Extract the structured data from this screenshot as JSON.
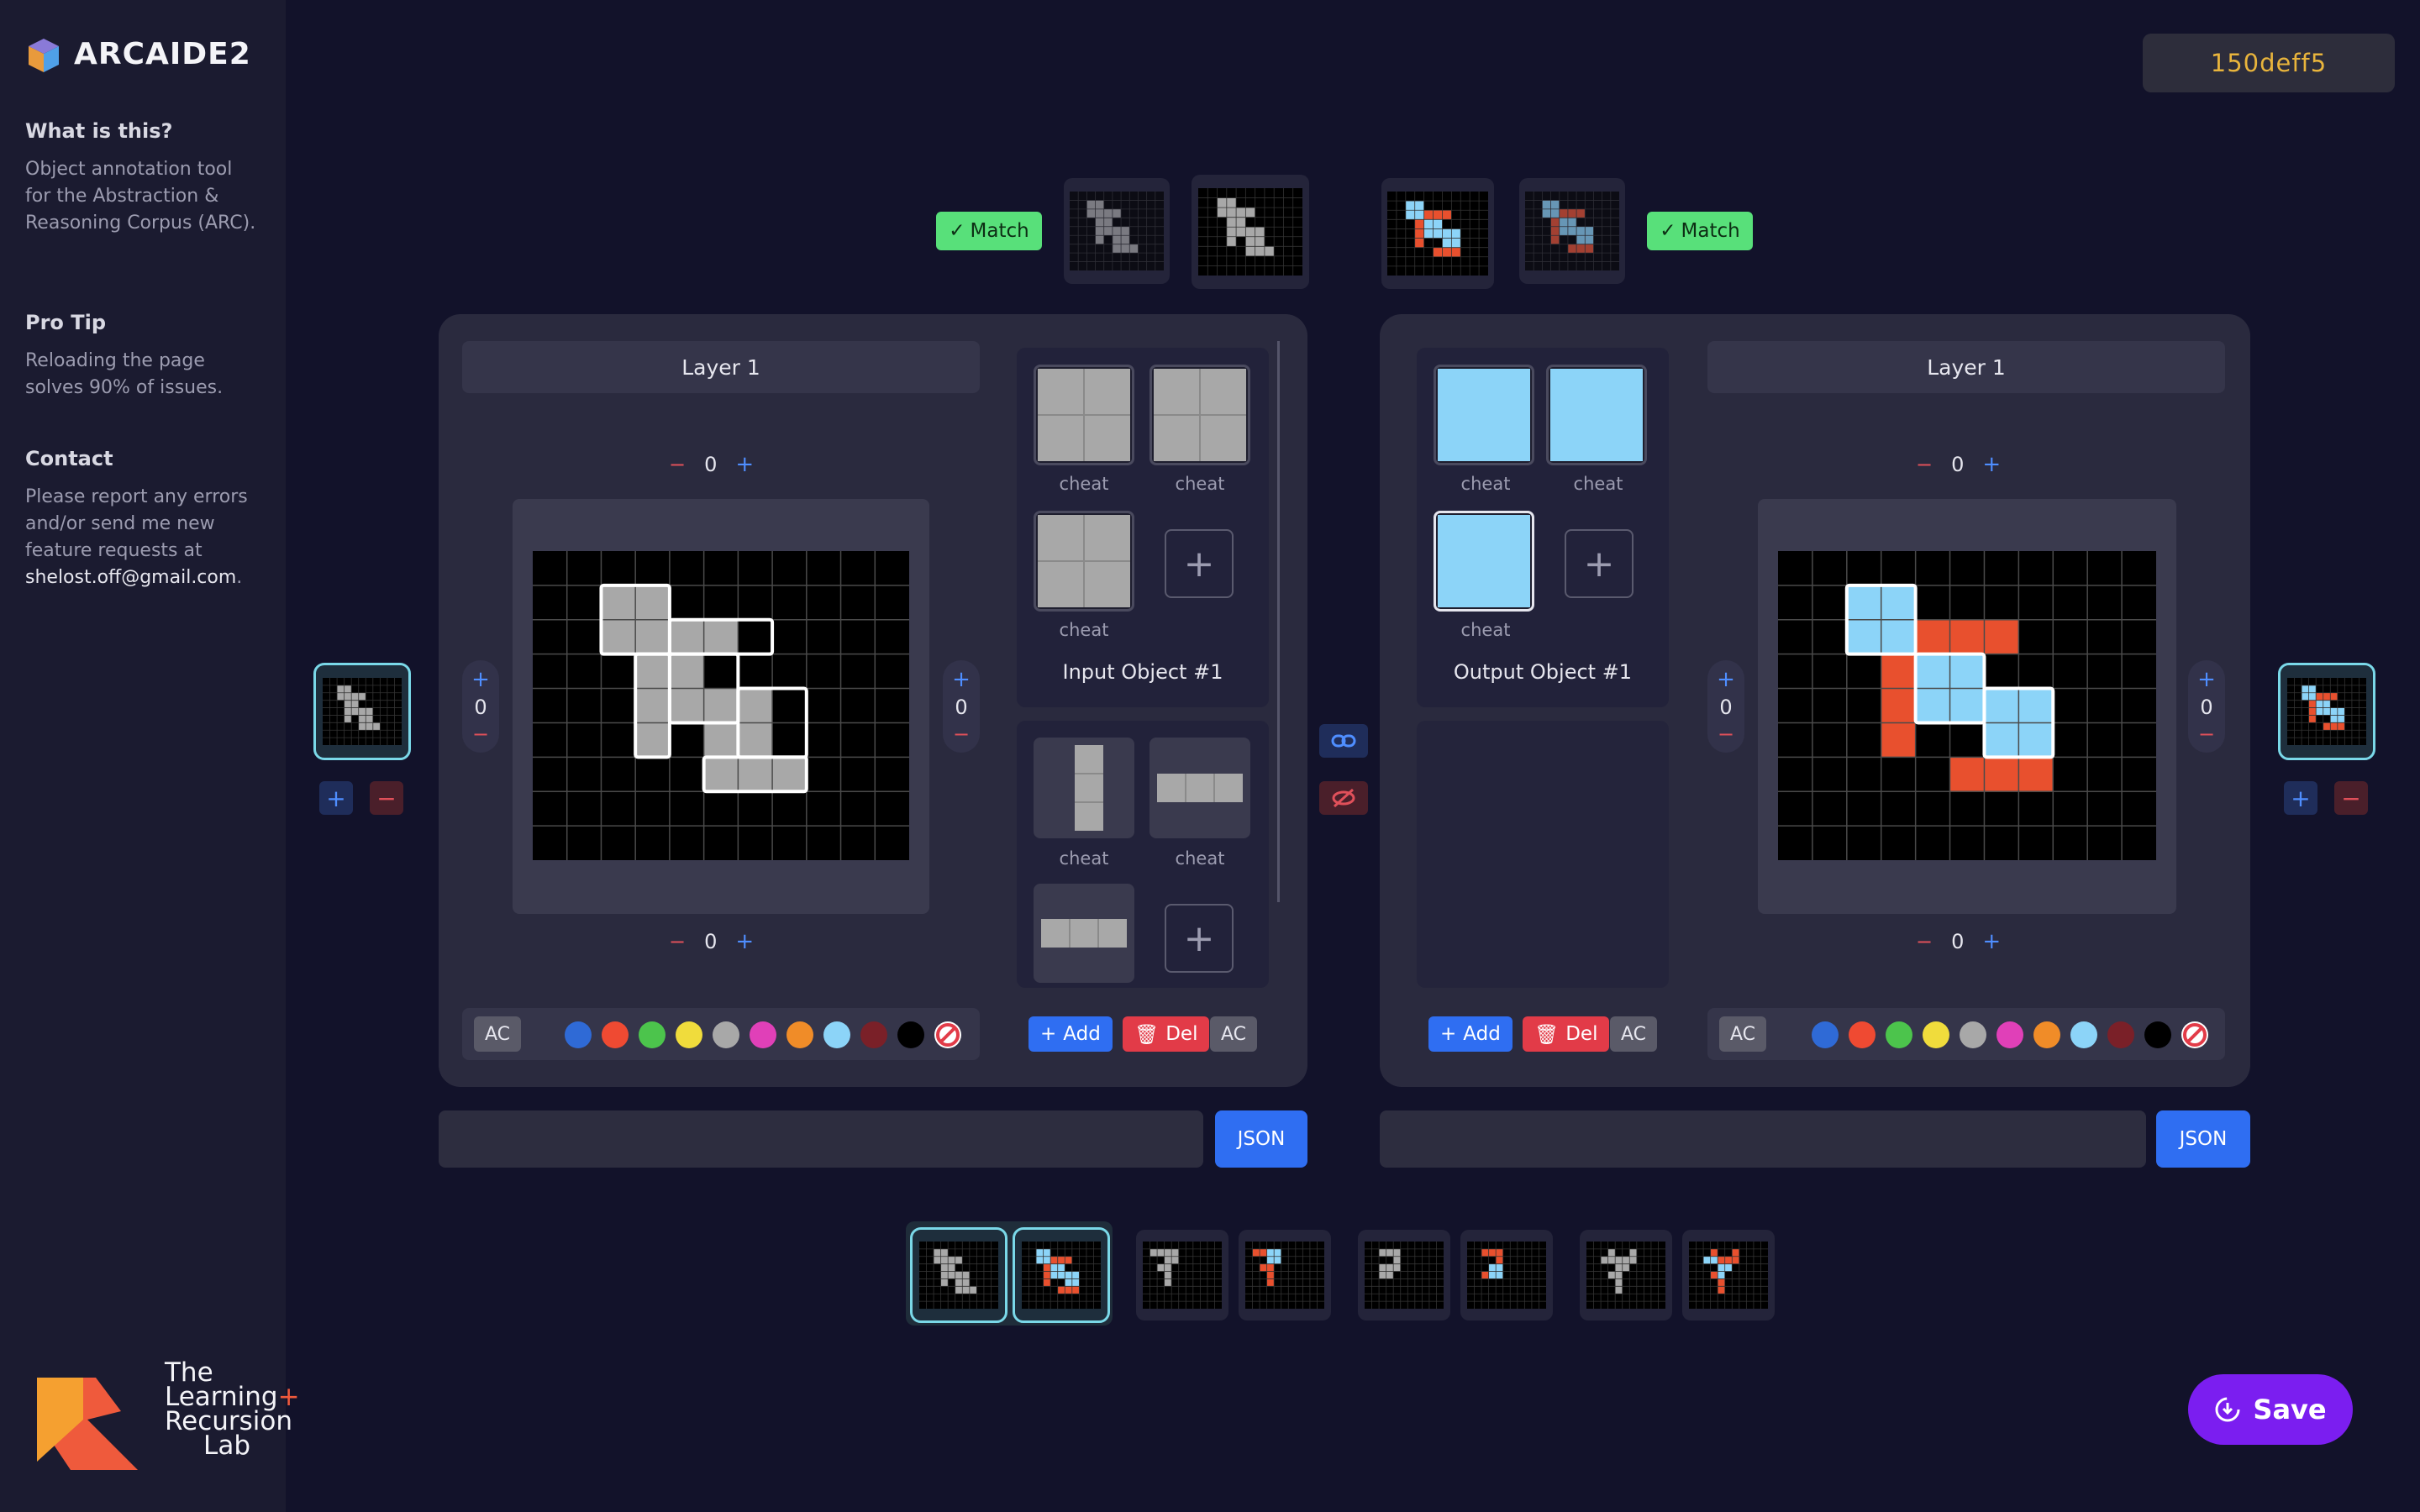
{
  "app": {
    "title_main": "ARCAIDE",
    "title_suffix": "2"
  },
  "sidebar": {
    "sections": [
      {
        "heading": "What is this?",
        "text": "Object annotation tool for the Abstraction & Reasoning Corpus (ARC)."
      },
      {
        "heading": "Pro Tip",
        "text": "Reloading the page solves 90% of issues."
      },
      {
        "heading": "Contact",
        "text": "Please report any errors and/or send me new feature requests at",
        "email": "shelost.off@gmail.com",
        "suffix": "."
      }
    ],
    "lab": {
      "line1": "The",
      "line2": "Learning",
      "plus": "+",
      "line3": "Recursion",
      "line4": "Lab"
    }
  },
  "task_id": "150deff5",
  "match_label": "Match",
  "colors": {
    "accent": "#2f6ef2",
    "danger": "#e23b48",
    "match": "#58e07a",
    "save": "#7b1ef0",
    "cell_grey": "#a8a8a8",
    "cell_blue": "#8cd4f8",
    "cell_red": "#e8502e"
  },
  "palette": [
    "#2f6ad6",
    "#ef4a32",
    "#4cc44c",
    "#f0dc3c",
    "#a8a8a8",
    "#e040b8",
    "#f08c28",
    "#8cd4f8",
    "#7a2028",
    "#000000",
    "forbidden"
  ],
  "input_panel": {
    "layer_label": "Layer 1",
    "top_stepper": {
      "value": "0",
      "minus": "−",
      "plus": "+"
    },
    "bottom_stepper": {
      "value": "0",
      "minus": "−",
      "plus": "+"
    },
    "left_stepper": {
      "value": "0"
    },
    "right_stepper": {
      "value": "0"
    },
    "object_title": "Input Object #1",
    "objects": [
      {
        "label": "cheat"
      },
      {
        "label": "cheat"
      },
      {
        "label": "cheat"
      }
    ],
    "objects2": [
      {
        "label": "cheat"
      },
      {
        "label": "cheat"
      }
    ],
    "ac": "AC",
    "add": "Add",
    "del": "Del",
    "json": "JSON"
  },
  "output_panel": {
    "layer_label": "Layer 1",
    "top_stepper": {
      "value": "0",
      "minus": "−",
      "plus": "+"
    },
    "bottom_stepper": {
      "value": "0",
      "minus": "−",
      "plus": "+"
    },
    "left_stepper": {
      "value": "0"
    },
    "right_stepper": {
      "value": "0"
    },
    "object_title": "Output Object #1",
    "objects": [
      {
        "label": "cheat"
      },
      {
        "label": "cheat"
      },
      {
        "label": "cheat"
      }
    ],
    "ac": "AC",
    "add": "Add",
    "del": "Del",
    "json": "JSON"
  },
  "save_label": "Save"
}
